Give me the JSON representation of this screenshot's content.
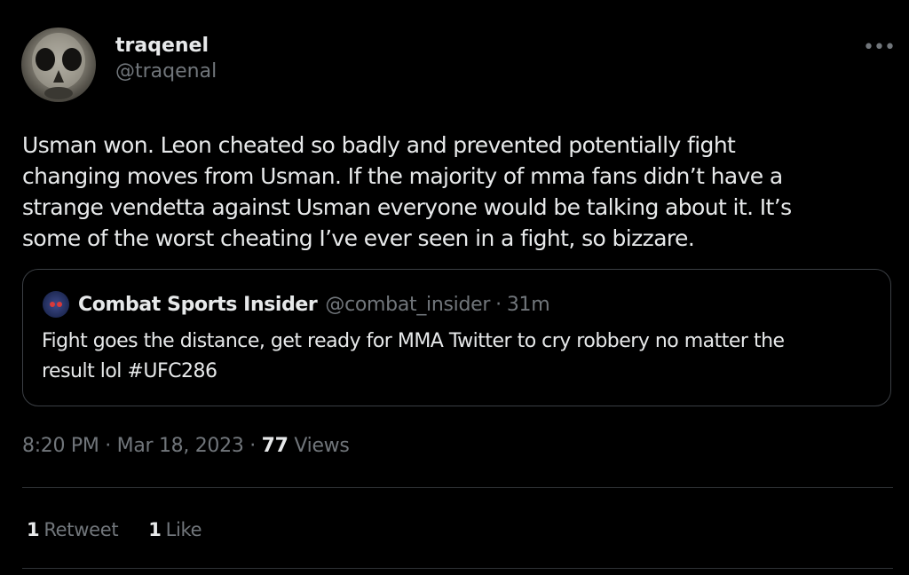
{
  "author": {
    "display_name": "traqenel",
    "handle": "@traqenal"
  },
  "more_options_icon": "more-horizontal-icon",
  "tweet": {
    "text_lines": [
      "Usman won. Leon cheated so badly and prevented potentially fight",
      "changing moves from Usman. If the majority of mma fans didn’t have a",
      "strange vendetta against Usman everyone would be talking about it. It’s",
      "some of the worst cheating I’ve ever seen in a fight, so bizzare."
    ]
  },
  "quoted_tweet": {
    "display_name": "Combat Sports Insider",
    "handle": "@combat_insider",
    "separator": "·",
    "time": "31m",
    "text_lines": [
      "Fight goes the distance, get ready for MMA Twitter to cry robbery no matter the",
      "result lol #UFC286"
    ]
  },
  "meta": {
    "time": "8:20 PM",
    "separator1": "·",
    "date": "Mar 18, 2023",
    "separator2": "·",
    "views_count": "77",
    "views_label": "Views"
  },
  "stats": {
    "retweets_count": "1",
    "retweets_label": "Retweet",
    "likes_count": "1",
    "likes_label": "Like"
  },
  "colors": {
    "background": "#000000",
    "primary_text": "#e7e9ea",
    "secondary_text": "#71767b",
    "border": "#3b3f44"
  }
}
